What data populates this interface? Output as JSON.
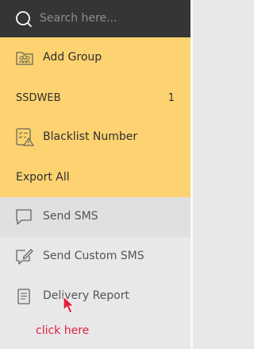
{
  "search": {
    "placeholder": "Search here..."
  },
  "menu": {
    "add_group": "Add Group",
    "group_name": "SSDWEB",
    "group_count": "1",
    "blacklist": "Blacklist Number",
    "export_all": "Export All"
  },
  "nav": {
    "send_sms": "Send SMS",
    "send_custom_sms": "Send Custom SMS",
    "delivery_report": "Delivery Report"
  },
  "annotation": {
    "text": "click here"
  },
  "colors": {
    "search_bg": "#353535",
    "yellow_panel": "#fdd271",
    "grey_bg": "#e8e8e8",
    "annotation": "#e02040"
  },
  "icons": [
    "search-icon",
    "add-group-icon",
    "blacklist-icon",
    "chat-bubble-icon",
    "edit-message-icon",
    "document-icon",
    "cursor-arrow-icon"
  ]
}
